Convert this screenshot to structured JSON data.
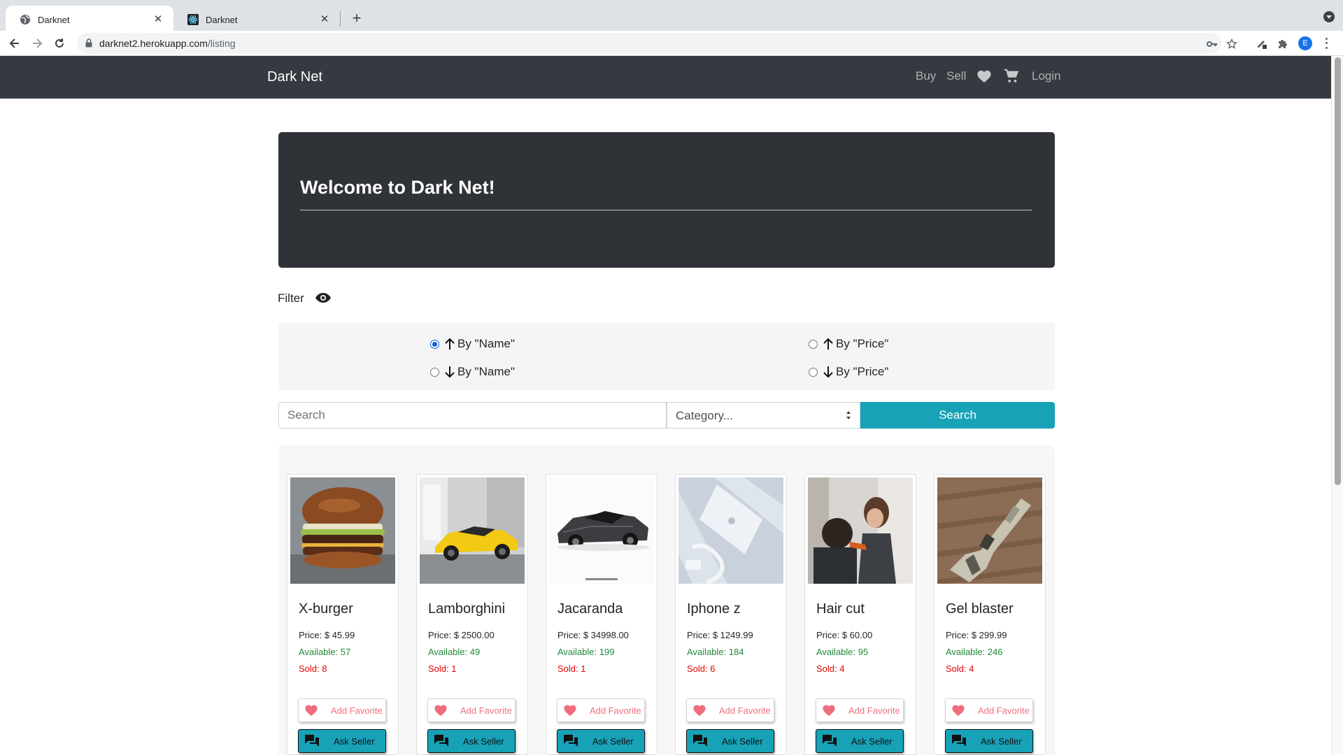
{
  "browser": {
    "tabs": [
      {
        "title": "Darknet",
        "active": true,
        "favicon": "globe-icon"
      },
      {
        "title": "Darknet",
        "active": false,
        "favicon": "react-icon"
      }
    ],
    "url_host": "darknet2.herokuapp.com",
    "url_path": "/listing",
    "profile_initial": "E"
  },
  "navbar": {
    "brand": "Dark Net",
    "links": {
      "buy": "Buy",
      "sell": "Sell",
      "login": "Login"
    },
    "icons": [
      "heart-icon",
      "cart-icon"
    ]
  },
  "jumbotron": {
    "title": "Welcome to Dark Net!"
  },
  "filter": {
    "label": "Filter",
    "icon": "eye-icon",
    "options": [
      {
        "direction": "up",
        "label": "By \"Name\"",
        "checked": true
      },
      {
        "direction": "up",
        "label": "By \"Price\"",
        "checked": false
      },
      {
        "direction": "down",
        "label": "By \"Name\"",
        "checked": false
      },
      {
        "direction": "down",
        "label": "By \"Price\"",
        "checked": false
      }
    ]
  },
  "search": {
    "placeholder": "Search",
    "category_selected": "Category...",
    "button_label": "Search"
  },
  "colors": {
    "navbar": "#343a40",
    "jumbotron": "#2f3337",
    "accent": "#17a2b8",
    "available": "#218838",
    "sold": "#e60000",
    "favorite": "#f2707e"
  },
  "products": [
    {
      "name": "X-burger",
      "price": "Price: $ 45.99",
      "available": "Available: 57",
      "sold": "Sold: 8",
      "favorite_label": "Add Favorite",
      "ask_label": "Ask Seller"
    },
    {
      "name": "Lamborghini",
      "price": "Price: $ 2500.00",
      "available": "Available: 49",
      "sold": "Sold: 1",
      "favorite_label": "Add Favorite",
      "ask_label": "Ask Seller"
    },
    {
      "name": "Jacaranda",
      "price": "Price: $ 34998.00",
      "available": "Available: 199",
      "sold": "Sold: 1",
      "favorite_label": "Add Favorite",
      "ask_label": "Ask Seller"
    },
    {
      "name": "Iphone z",
      "price": "Price: $ 1249.99",
      "available": "Available: 184",
      "sold": "Sold: 6",
      "favorite_label": "Add Favorite",
      "ask_label": "Ask Seller"
    },
    {
      "name": "Hair cut",
      "price": "Price: $ 60.00",
      "available": "Available: 95",
      "sold": "Sold: 4",
      "favorite_label": "Add Favorite",
      "ask_label": "Ask Seller"
    },
    {
      "name": "Gel blaster",
      "price": "Price: $ 299.99",
      "available": "Available: 246",
      "sold": "Sold: 4",
      "favorite_label": "Add Favorite",
      "ask_label": "Ask Seller"
    }
  ]
}
